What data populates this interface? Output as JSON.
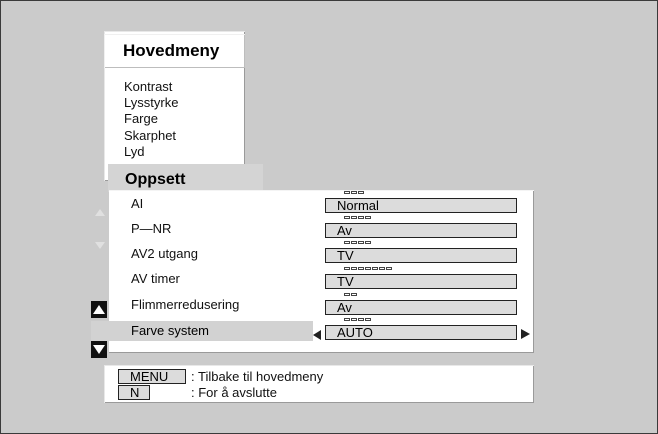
{
  "main_menu": {
    "title": "Hovedmeny",
    "items": [
      "Kontrast",
      "Lysstyrke",
      "Farge",
      "Skarphet",
      "Lyd"
    ]
  },
  "setup_tab": {
    "label": "Oppsett"
  },
  "settings": [
    {
      "label": "AI",
      "value": "Normal",
      "option_count": 3,
      "selected": false
    },
    {
      "label": "P—NR",
      "value": "Av",
      "option_count": 4,
      "selected": false
    },
    {
      "label": "AV2 utgang",
      "value": "TV",
      "option_count": 4,
      "selected": false
    },
    {
      "label": "AV timer",
      "value": "TV",
      "option_count": 7,
      "selected": false
    },
    {
      "label": "Flimmerredusering",
      "value": "Av",
      "option_count": 2,
      "selected": false
    },
    {
      "label": "Farve system",
      "value": "AUTO",
      "option_count": 4,
      "selected": true
    }
  ],
  "help": [
    {
      "key": "MENU",
      "text": ": Tilbake til hovedmeny"
    },
    {
      "key": "N",
      "text": ": For å avslutte"
    }
  ],
  "icons": {
    "scroll_up": "triangle-up-icon",
    "scroll_down": "triangle-down-icon",
    "value_prev": "triangle-left-icon",
    "value_next": "triangle-right-icon"
  },
  "colors": {
    "background": "#cbcbcb",
    "panel": "#ffffff",
    "selection": "#d2d2d2",
    "value_box": "#dcdcdc"
  }
}
